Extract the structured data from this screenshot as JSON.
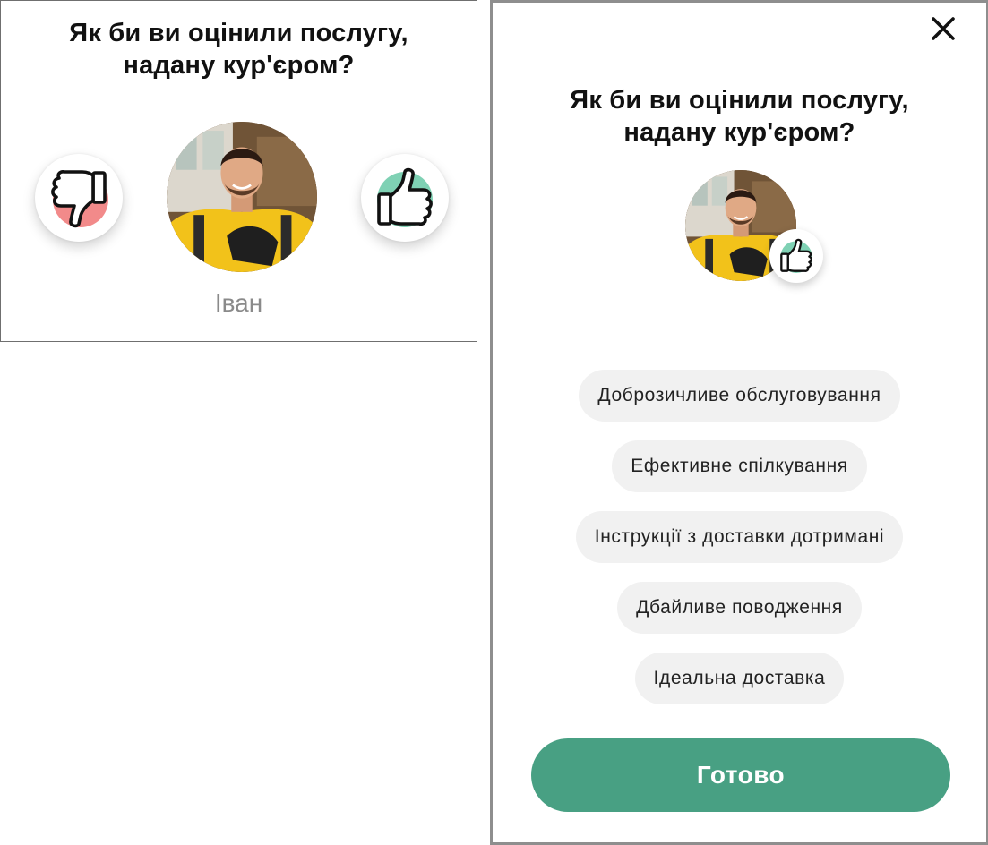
{
  "colors": {
    "accent": "#48a083",
    "like_circle": "#7fd1b4",
    "dislike_circle": "#f28a8a",
    "chip_bg": "#f1f1f1",
    "name_gray": "#8a8a8a"
  },
  "left_panel": {
    "title_line1": "Як би ви оцінили послугу,",
    "title_line2": "надану кур'єром?",
    "dislike_icon": "thumbs-down-icon",
    "like_icon": "thumbs-up-icon",
    "courier_name": "Іван"
  },
  "right_panel": {
    "close_icon": "close-icon",
    "title_line1": "Як би ви оцінили послугу,",
    "title_line2": "надану кур'єром?",
    "badge_icon": "thumbs-up-icon",
    "tags": [
      "Доброзичливе обслуговування",
      "Ефективне спілкування",
      "Інструкції з доставки дотримані",
      "Дбайливе поводження",
      "Ідеальна доставка"
    ],
    "done_label": "Готово"
  }
}
